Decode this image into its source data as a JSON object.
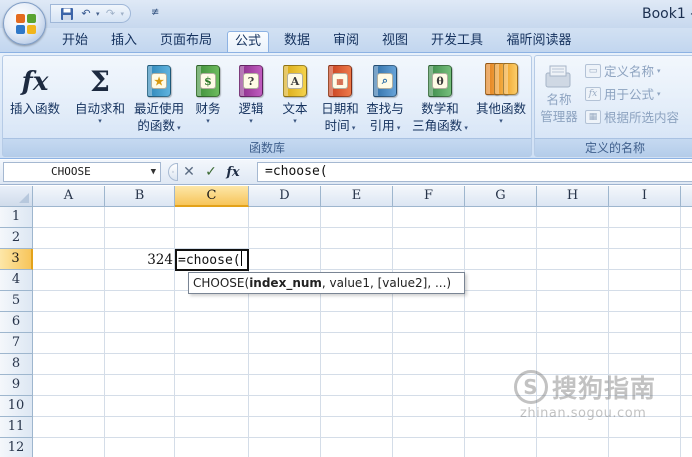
{
  "window": {
    "title": "Book1 -"
  },
  "quick_access": {
    "save_icon": "save-icon",
    "undo_icon": "undo-icon",
    "redo_icon": "redo-icon",
    "more": "≢"
  },
  "tabs": [
    {
      "label": "开始"
    },
    {
      "label": "插入"
    },
    {
      "label": "页面布局"
    },
    {
      "label": "公式",
      "active": true
    },
    {
      "label": "数据"
    },
    {
      "label": "审阅"
    },
    {
      "label": "视图"
    },
    {
      "label": "开发工具"
    },
    {
      "label": "福昕阅读器"
    }
  ],
  "ribbon": {
    "function_library": {
      "label": "函数库",
      "buttons": {
        "insert_function": {
          "label": "插入函数",
          "icon": "fx-icon"
        },
        "autosum": {
          "label": "自动求和",
          "icon": "sigma-icon"
        },
        "recent": {
          "label": "最近使用",
          "label2": "的函数",
          "icon": "star-book-icon"
        },
        "financial": {
          "label": "财务",
          "icon": "money-book-icon"
        },
        "logical": {
          "label": "逻辑",
          "icon": "question-book-icon"
        },
        "text": {
          "label": "文本",
          "icon": "text-book-icon",
          "glyph": "A"
        },
        "datetime": {
          "label": "日期和",
          "label2": "时间",
          "icon": "calendar-book-icon"
        },
        "lookup": {
          "label": "查找与",
          "label2": "引用",
          "icon": "magnifier-book-icon"
        },
        "math": {
          "label": "数学和",
          "label2": "三角函数",
          "icon": "theta-book-icon",
          "glyph": "θ"
        },
        "more": {
          "label": "其他函数",
          "icon": "multi-book-icon"
        }
      }
    },
    "defined_names": {
      "label": "定义的名称",
      "name_manager": {
        "label": "名称",
        "label2": "管理器",
        "icon": "name-manager-icon"
      },
      "define_name": {
        "label": "定义名称"
      },
      "use_in_formula": {
        "label": "用于公式"
      },
      "create_from_selection": {
        "label": "根据所选内容"
      }
    }
  },
  "formula_bar": {
    "name_box": "CHOOSE",
    "cancel": "✕",
    "enter": "✓",
    "insert_fx": "fx",
    "formula": "=choose("
  },
  "sheet": {
    "columns": [
      "A",
      "B",
      "C",
      "D",
      "E",
      "F",
      "G",
      "H",
      "I"
    ],
    "rows": [
      "1",
      "2",
      "3",
      "4",
      "5",
      "6",
      "7",
      "8",
      "9",
      "10",
      "11",
      "12"
    ],
    "selected_column": "C",
    "selected_row": "3",
    "cells": {
      "B3": "324",
      "C3": "=choose("
    }
  },
  "tooltip": {
    "fn": "CHOOSE(",
    "arg1": "index_num",
    "rest": ", value1, [value2], ...)"
  },
  "watermark": {
    "logo_char": "S",
    "main": "搜狗指南",
    "sub": "zhinan.sogou.com"
  },
  "colors": {
    "accent": "#e3a21a",
    "ribbon_border": "#8db2e3"
  }
}
